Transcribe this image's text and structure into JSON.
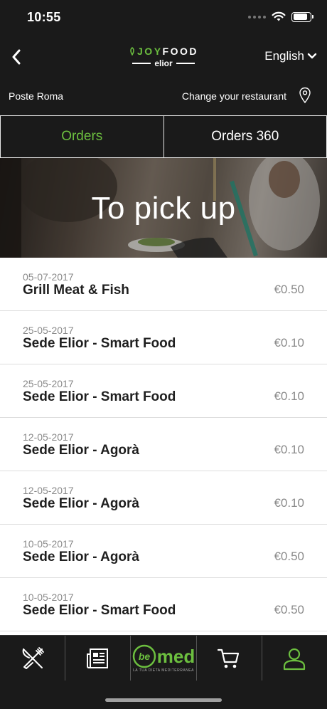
{
  "status_bar": {
    "time": "10:55"
  },
  "header": {
    "logo": {
      "brand": "JOYFOOD",
      "brand_prefix": "JOY",
      "brand_suffix": "FOOD",
      "sub": "elior"
    },
    "language": "English"
  },
  "restaurant": {
    "name": "Poste Roma",
    "change_label": "Change your restaurant"
  },
  "tabs": [
    {
      "label": "Orders",
      "active": true
    },
    {
      "label": "Orders 360",
      "active": false
    }
  ],
  "hero": {
    "title": "To pick up"
  },
  "orders": [
    {
      "date": "05-07-2017",
      "name": "Grill Meat & Fish",
      "price": "€0.50"
    },
    {
      "date": "25-05-2017",
      "name": "Sede Elior - Smart Food",
      "price": "€0.10"
    },
    {
      "date": "25-05-2017",
      "name": "Sede Elior - Smart Food",
      "price": "€0.10"
    },
    {
      "date": "12-05-2017",
      "name": "Sede Elior - Agorà",
      "price": "€0.10"
    },
    {
      "date": "12-05-2017",
      "name": "Sede Elior - Agorà",
      "price": "€0.10"
    },
    {
      "date": "10-05-2017",
      "name": "Sede Elior - Agorà",
      "price": "€0.50"
    },
    {
      "date": "10-05-2017",
      "name": "Sede Elior - Smart Food",
      "price": "€0.50"
    }
  ],
  "bottom_nav": {
    "items": [
      "restaurant-icon",
      "news-icon",
      "bemed-logo",
      "cart-icon",
      "profile-icon"
    ],
    "bemed": {
      "be": "be",
      "med": "med",
      "tagline": "LA TUA DIETA MEDITERRANEA"
    },
    "active": "profile-icon"
  },
  "colors": {
    "accent": "#6cbf3f",
    "background": "#1a1a1a",
    "list_background": "#ffffff",
    "muted_text": "#8a8a8a"
  }
}
